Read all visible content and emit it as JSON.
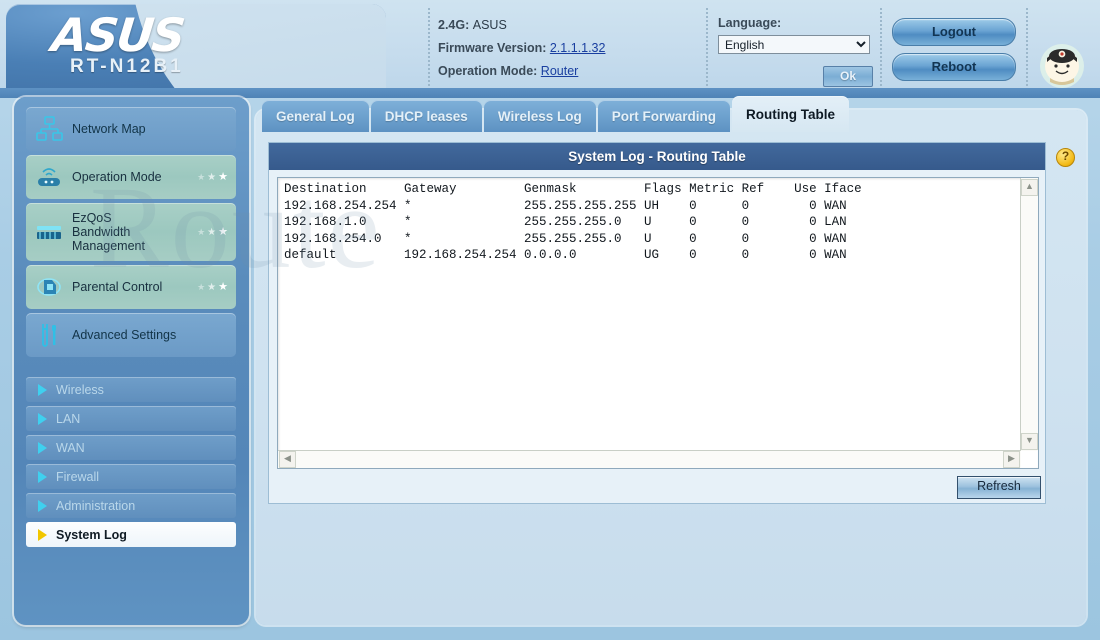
{
  "header": {
    "brand": "ASUS",
    "model": "RT-N12B1",
    "band_label": "2.4G:",
    "band_value": "ASUS",
    "firmware_label": "Firmware Version:",
    "firmware_value": "2.1.1.1.32",
    "opmode_label": "Operation Mode:",
    "opmode_value": "Router",
    "language_label": "Language:",
    "language_value": "English",
    "language_options": [
      "English"
    ],
    "ok_label": "Ok",
    "logout_label": "Logout",
    "reboot_label": "Reboot",
    "avatar_icon": "mascot-face-icon"
  },
  "sidebar": {
    "top_items": [
      {
        "label": "Network Map",
        "icon": "network-map-icon",
        "highlight": false,
        "stars": 0
      },
      {
        "label": "Operation Mode",
        "icon": "router-wifi-icon",
        "highlight": true,
        "stars": 3
      },
      {
        "label": "EzQoS Bandwidth Management",
        "icon": "bandwidth-bars-icon",
        "highlight": true,
        "stars": 3
      },
      {
        "label": "Parental Control",
        "icon": "parental-control-icon",
        "highlight": true,
        "stars": 3
      },
      {
        "label": "Advanced Settings",
        "icon": "wrench-screwdriver-icon",
        "highlight": false,
        "stars": 0
      }
    ],
    "bottom_items": [
      {
        "label": "Wireless",
        "active": false
      },
      {
        "label": "LAN",
        "active": false
      },
      {
        "label": "WAN",
        "active": false
      },
      {
        "label": "Firewall",
        "active": false
      },
      {
        "label": "Administration",
        "active": false
      },
      {
        "label": "System Log",
        "active": true
      }
    ]
  },
  "main": {
    "tabs": [
      {
        "label": "General Log",
        "active": false
      },
      {
        "label": "DHCP leases",
        "active": false
      },
      {
        "label": "Wireless Log",
        "active": false
      },
      {
        "label": "Port Forwarding",
        "active": false
      },
      {
        "label": "Routing Table",
        "active": true
      }
    ],
    "panel_title": "System Log - Routing Table",
    "help_icon": "help-question-icon",
    "refresh_label": "Refresh",
    "routing_table": {
      "columns": [
        "Destination",
        "Gateway",
        "Genmask",
        "Flags",
        "Metric",
        "Ref",
        "Use",
        "Iface"
      ],
      "rows": [
        [
          "192.168.254.254",
          "*",
          "255.255.255.255",
          "UH",
          "0",
          "0",
          "0",
          "WAN"
        ],
        [
          "192.168.1.0",
          "*",
          "255.255.255.0",
          "U",
          "0",
          "0",
          "0",
          "LAN"
        ],
        [
          "192.168.254.0",
          "*",
          "255.255.255.0",
          "U",
          "0",
          "0",
          "0",
          "WAN"
        ],
        [
          "default",
          "192.168.254.254",
          "0.0.0.0",
          "UG",
          "0",
          "0",
          "0",
          "WAN"
        ]
      ],
      "text": "Destination     Gateway         Genmask         Flags Metric Ref    Use Iface\n192.168.254.254 *               255.255.255.255 UH    0      0        0 WAN\n192.168.1.0     *               255.255.255.0   U     0      0        0 LAN\n192.168.254.0   *               255.255.255.0   U     0      0        0 WAN\ndefault         192.168.254.254 0.0.0.0         UG    0      0        0 WAN"
    }
  },
  "watermark": "Route",
  "colors": {
    "accent": "#4f83b6",
    "panel_title_bg": "#3b6093",
    "active_tab_bg": "#dceaf4",
    "highlight_green": "#a4cdc3"
  }
}
